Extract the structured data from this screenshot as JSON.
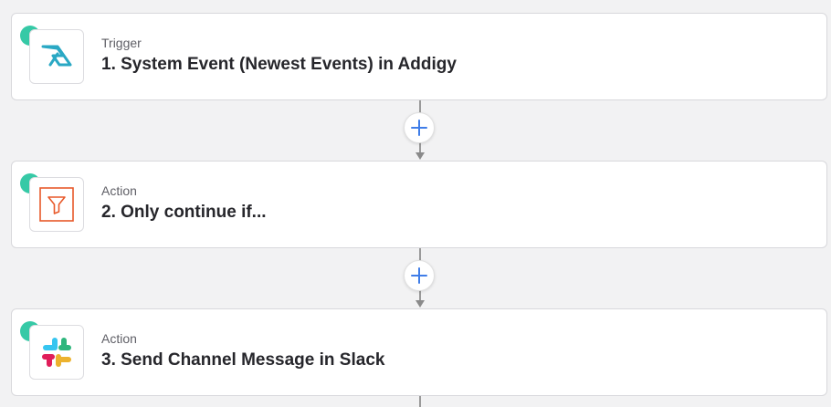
{
  "steps": [
    {
      "kind": "Trigger",
      "title": "1. System Event (Newest Events) in Addigy",
      "app_icon": "addigy-logo-icon"
    },
    {
      "kind": "Action",
      "title": "2. Only continue if...",
      "app_icon": "filter-icon"
    },
    {
      "kind": "Action",
      "title": "3. Send Channel Message in Slack",
      "app_icon": "slack-logo-icon"
    }
  ],
  "add_step_icon": "plus-icon",
  "colors": {
    "status_dot": "#36c9a6",
    "plus": "#3f7de8",
    "addigy": "#2aa8c4",
    "filter": "#e8592a",
    "background": "#f2f2f3"
  }
}
